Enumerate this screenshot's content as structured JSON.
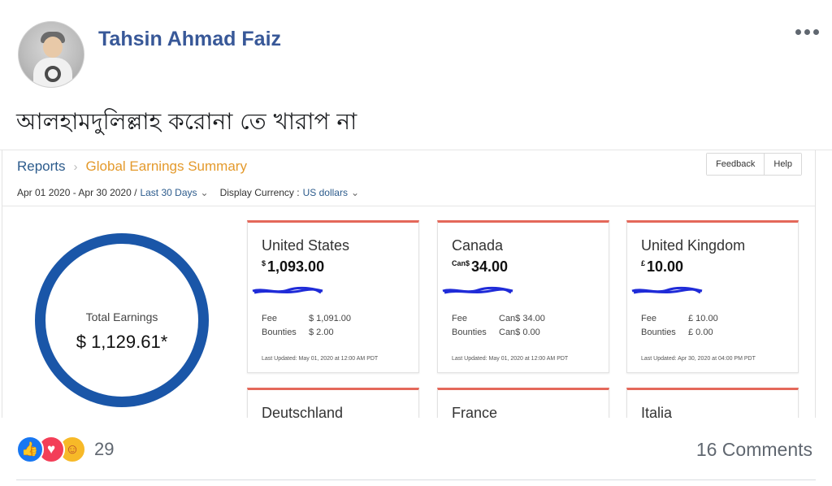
{
  "post": {
    "author": "Tahsin Ahmad Faiz",
    "text": "আলহামদুলিল্লাহ করোনা তে খারাপ না"
  },
  "screenshot": {
    "breadcrumb": {
      "reports": "Reports",
      "separator": "›",
      "current": "Global Earnings Summary"
    },
    "filters": {
      "date_range": "Apr 01 2020 - Apr 30 2020 /",
      "period": "Last 30 Days",
      "currency_label": "Display Currency :",
      "currency_value": "US dollars"
    },
    "buttons": {
      "feedback": "Feedback",
      "help": "Help"
    },
    "total": {
      "label": "Total Earnings",
      "value": "$ 1,129.61*"
    },
    "cards": [
      {
        "name": "United States",
        "symbol": "$",
        "amount": "1,093.00",
        "fee_label": "Fee",
        "fee": "$ 1,091.00",
        "bounties_label": "Bounties",
        "bounties": "$ 2.00",
        "updated": "Last Updated: May 01, 2020 at 12:00 AM PDT"
      },
      {
        "name": "Canada",
        "symbol": "Can$",
        "amount": "34.00",
        "fee_label": "Fee",
        "fee": "Can$ 34.00",
        "bounties_label": "Bounties",
        "bounties": "Can$ 0.00",
        "updated": "Last Updated: May 01, 2020 at 12:00 AM PDT"
      },
      {
        "name": "United Kingdom",
        "symbol": "£",
        "amount": "10.00",
        "fee_label": "Fee",
        "fee": "£ 10.00",
        "bounties_label": "Bounties",
        "bounties": "£ 0.00",
        "updated": "Last Updated: Apr 30, 2020 at 04:00 PM PDT"
      }
    ],
    "bottom_cards": [
      "Deutschland",
      "France",
      "Italia"
    ]
  },
  "footer": {
    "reaction_count": "29",
    "comments": "16 Comments",
    "reactions": [
      "like-icon",
      "love-icon",
      "care-icon"
    ]
  },
  "colors": {
    "author": "#385898",
    "ring": "#1a56a8",
    "card_top": "#e4685a",
    "breadcrumb_current": "#e49a2c",
    "scribble": "#1f2bd8"
  }
}
